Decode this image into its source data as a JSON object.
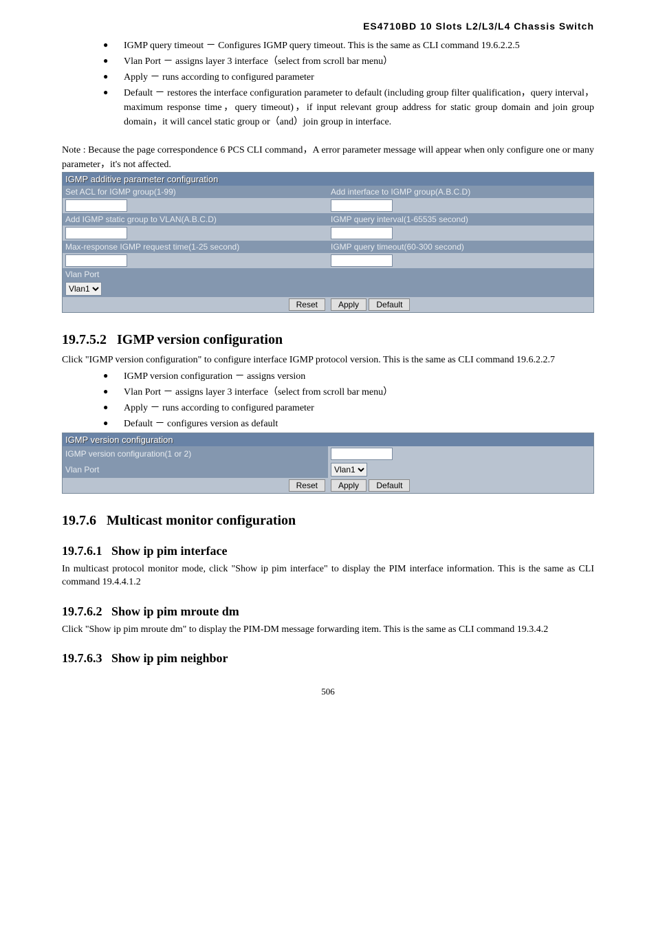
{
  "header": {
    "title": "ES4710BD 10 Slots L2/L3/L4 Chassis Switch"
  },
  "top_bullets": [
    "IGMP query timeout － Configures IGMP query timeout. This is the same as CLI command 19.6.2.2.5",
    "Vlan Port － assigns layer 3 interface（select from scroll bar menu）",
    "Apply － runs according to configured parameter",
    "Default － restores the interface configuration parameter to default (including group filter qualification，query interval，maximum response time，query timeout)，if input relevant group address for static group domain and join group domain，it will cancel static group or（and）join group in interface."
  ],
  "note": "Note : Because the page correspondence 6 PCS CLI command，A error parameter message will appear when only configure one or many parameter，it's not affected.",
  "panel1": {
    "title": "IGMP additive parameter configuration",
    "row1a": "Set ACL for IGMP group(1-99)",
    "row1b": "Add interface to IGMP group(A.B.C.D)",
    "row2a": "Add IGMP static group to VLAN(A.B.C.D)",
    "row2b": "IGMP query interval(1-65535 second)",
    "row3a": "Max-response IGMP request time(1-25 second)",
    "row3b": "IGMP query timeout(60-300 second)",
    "vlan_label": "Vlan Port",
    "vlan_value": "Vlan1",
    "btn_reset": "Reset",
    "btn_apply": "Apply",
    "btn_default": "Default"
  },
  "section1": {
    "num": "19.7.5.2",
    "title": "IGMP version configuration",
    "desc": "Click \"IGMP version configuration\" to configure interface IGMP protocol version. This is the same as CLI command 19.6.2.2.7",
    "bullets": [
      "IGMP version configuration － assigns version",
      "Vlan Port － assigns layer 3 interface（select from scroll bar menu）",
      "Apply － runs according to configured parameter",
      "Default － configures version as default"
    ]
  },
  "panel2": {
    "title": "IGMP version configuration",
    "row1a": "IGMP version configuration(1 or 2)",
    "row2a": "Vlan Port",
    "vlan_value": "Vlan1",
    "btn_reset": "Reset",
    "btn_apply": "Apply",
    "btn_default": "Default"
  },
  "section2": {
    "num": "19.7.6",
    "title": "Multicast monitor configuration"
  },
  "section3": {
    "num": "19.7.6.1",
    "title": "Show ip pim interface",
    "desc": "In multicast protocol monitor mode, click \"Show ip pim interface\" to display the PIM interface information. This is the same as CLI command 19.4.4.1.2"
  },
  "section4": {
    "num": "19.7.6.2",
    "title": "Show ip pim mroute dm",
    "desc": "Click \"Show ip pim mroute dm\" to display the PIM-DM message forwarding item. This is the same as CLI command 19.3.4.2"
  },
  "section5": {
    "num": "19.7.6.3",
    "title": "Show ip pim neighbor"
  },
  "page_number": "506"
}
